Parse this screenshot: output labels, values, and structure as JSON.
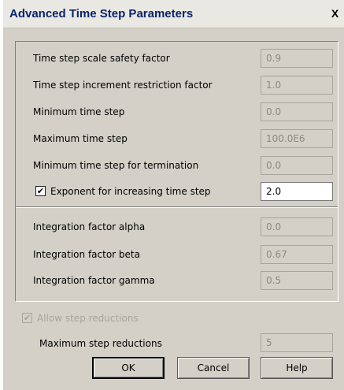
{
  "window": {
    "title": "Advanced Time Step Parameters",
    "close_glyph": "X"
  },
  "parameters": [
    {
      "label": "Time step scale safety factor",
      "value": "0.9"
    },
    {
      "label": "Time step increment restriction factor",
      "value": "1.0"
    },
    {
      "label": "Minimum time step",
      "value": "0.0"
    },
    {
      "label": "Maximum time step",
      "value": "100.0E6"
    },
    {
      "label": "Minimum time step for termination",
      "value": "0.0"
    }
  ],
  "exponent": {
    "checked": true,
    "check_glyph": "✔",
    "label": "Exponent for increasing time step",
    "value": "2.0"
  },
  "integration": [
    {
      "label": "Integration factor alpha",
      "value": "0.0"
    },
    {
      "label": "Integration factor beta",
      "value": "0.67"
    },
    {
      "label": "Integration factor gamma",
      "value": "0.5"
    }
  ],
  "step_reductions": {
    "checked": true,
    "enabled": false,
    "check_glyph": "✔",
    "label": "Allow step reductions",
    "max_label": "Maximum step reductions",
    "max_value": "5"
  },
  "buttons": {
    "ok": "OK",
    "cancel": "Cancel",
    "help": "Help"
  }
}
